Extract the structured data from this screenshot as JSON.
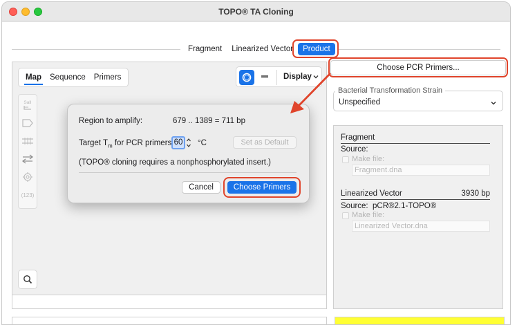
{
  "window": {
    "title": "TOPO® TA Cloning"
  },
  "segments": [
    {
      "label": "Fragment",
      "active": false
    },
    {
      "label": "Linearized Vector",
      "active": false
    },
    {
      "label": "Product",
      "active": true
    }
  ],
  "left": {
    "tabs": [
      {
        "label": "Map",
        "active": true
      },
      {
        "label": "Sequence",
        "active": false
      },
      {
        "label": "Primers",
        "active": false
      }
    ],
    "display_label": "Display",
    "tools": [
      "SalI-site-icon",
      "feature-shape-icon",
      "strands-icon",
      "swap-arrows-icon",
      "target-icon",
      "number-badge-icon"
    ],
    "tool_text": {
      "sali": "SalI",
      "num": "(123)"
    }
  },
  "dialog": {
    "region_label": "Region to amplify:",
    "region_value": "679 .. 1389  =  711 bp",
    "target_label_pre": "Target T",
    "target_label_sub": "m",
    "target_label_post": " for PCR primers:",
    "tm_value": "60",
    "tm_unit": "°C",
    "set_default": "Set as Default",
    "note": "(TOPO® cloning requires a nonphosphorylated insert.)",
    "cancel": "Cancel",
    "choose": "Choose Primers"
  },
  "right": {
    "pcr_button": "Choose PCR Primers...",
    "strain_legend": "Bacterial Transformation Strain",
    "strain_value": "Unspecified",
    "fragment": {
      "title": "Fragment",
      "source_label": "Source:",
      "source_value": "",
      "make_file": "Make file:",
      "file_name": "Fragment.dna"
    },
    "vector": {
      "title": "Linearized Vector",
      "size": "3930 bp",
      "source_label": "Source:",
      "source_value": "pCR®2.1-TOPO®",
      "make_file": "Make file:",
      "file_name": "Linearized Vector.dna"
    }
  },
  "colors": {
    "accent": "#1a73e8",
    "highlight": "#e0442b",
    "yellow": "#ffff33"
  }
}
